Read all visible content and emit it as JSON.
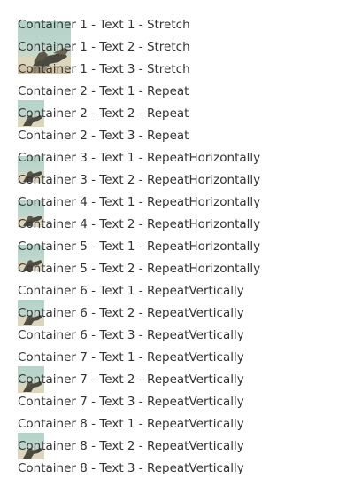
{
  "lines": [
    "Container 1 - Text 1 - Stretch",
    "Container 1 - Text 2 - Stretch",
    "Container 1 - Text 3 - Stretch",
    "Container 2 - Text 1 - Repeat",
    "Container 2 - Text 2 - Repeat",
    "Container 2 - Text 3 - Repeat",
    "Container 3 - Text 1 - RepeatHorizontally",
    "Container 3 - Text 2 - RepeatHorizontally",
    "Container 4 - Text 1 - RepeatHorizontally",
    "Container 4 - Text 2 - RepeatHorizontally",
    "Container 5 - Text 1 - RepeatHorizontally",
    "Container 5 - Text 2 - RepeatHorizontally",
    "Container 6 - Text 1 - RepeatVertically",
    "Container 6 - Text 2 - RepeatVertically",
    "Container 6 - Text 3 - RepeatVertically",
    "Container 7 - Text 1 - RepeatVertically",
    "Container 7 - Text 2 - RepeatVertically",
    "Container 7 - Text 3 - RepeatVertically",
    "Container 8 - Text 1 - RepeatVertically",
    "Container 8 - Text 2 - RepeatVertically",
    "Container 8 - Text 3 - RepeatVertically"
  ],
  "background_image": {
    "icon": "sculpture-photo-icon",
    "sky_color": "#b4d3c8",
    "ground_color": "#ddd6bf",
    "figure_color": "#4a4a40"
  }
}
